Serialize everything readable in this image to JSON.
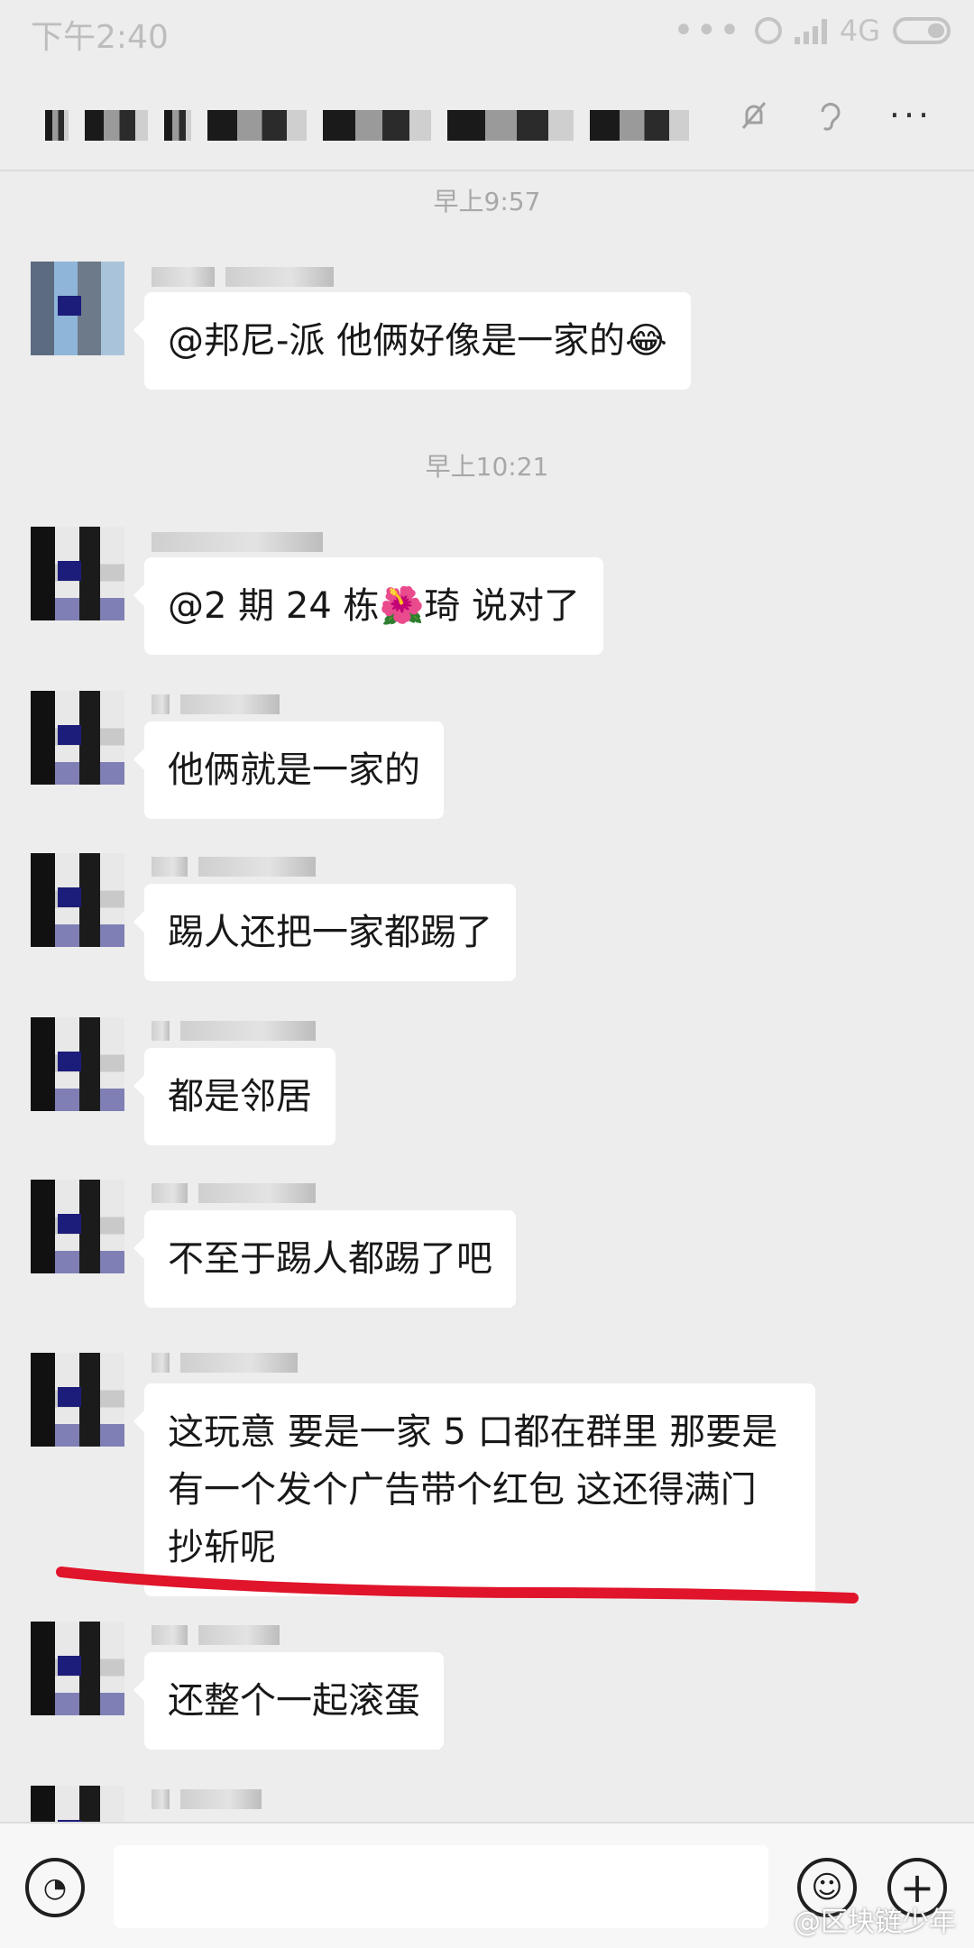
{
  "status_bar": {
    "time": "下午2:40",
    "network": "4G",
    "dots": "•••"
  },
  "header": {
    "more_label": "···"
  },
  "timestamps": [
    "早上9:57",
    "早上10:21"
  ],
  "messages": [
    {
      "text": "@邦尼-派  他俩好像是一家的😂"
    },
    {
      "text": "@2 期 24 栋🌺琦  说对了"
    },
    {
      "text": "他俩就是一家的"
    },
    {
      "text": "踢人还把一家都踢了"
    },
    {
      "text": "都是邻居"
    },
    {
      "text": "不至于踢人都踢了吧"
    },
    {
      "text": "这玩意 要是一家 5 口都在群里 那要是有一个发个广告带个红包 这还得满门抄斩呢"
    },
    {
      "text": "还整个一起滚蛋"
    }
  ],
  "input_bar": {
    "placeholder": "",
    "plus_symbol": "+",
    "emoji_symbol": "☺",
    "voice_symbol": "◔"
  },
  "watermark": "@区块链少年",
  "colors": {
    "bubble": "#ffffff",
    "background": "#ededed",
    "annotation": "#e0142a"
  }
}
